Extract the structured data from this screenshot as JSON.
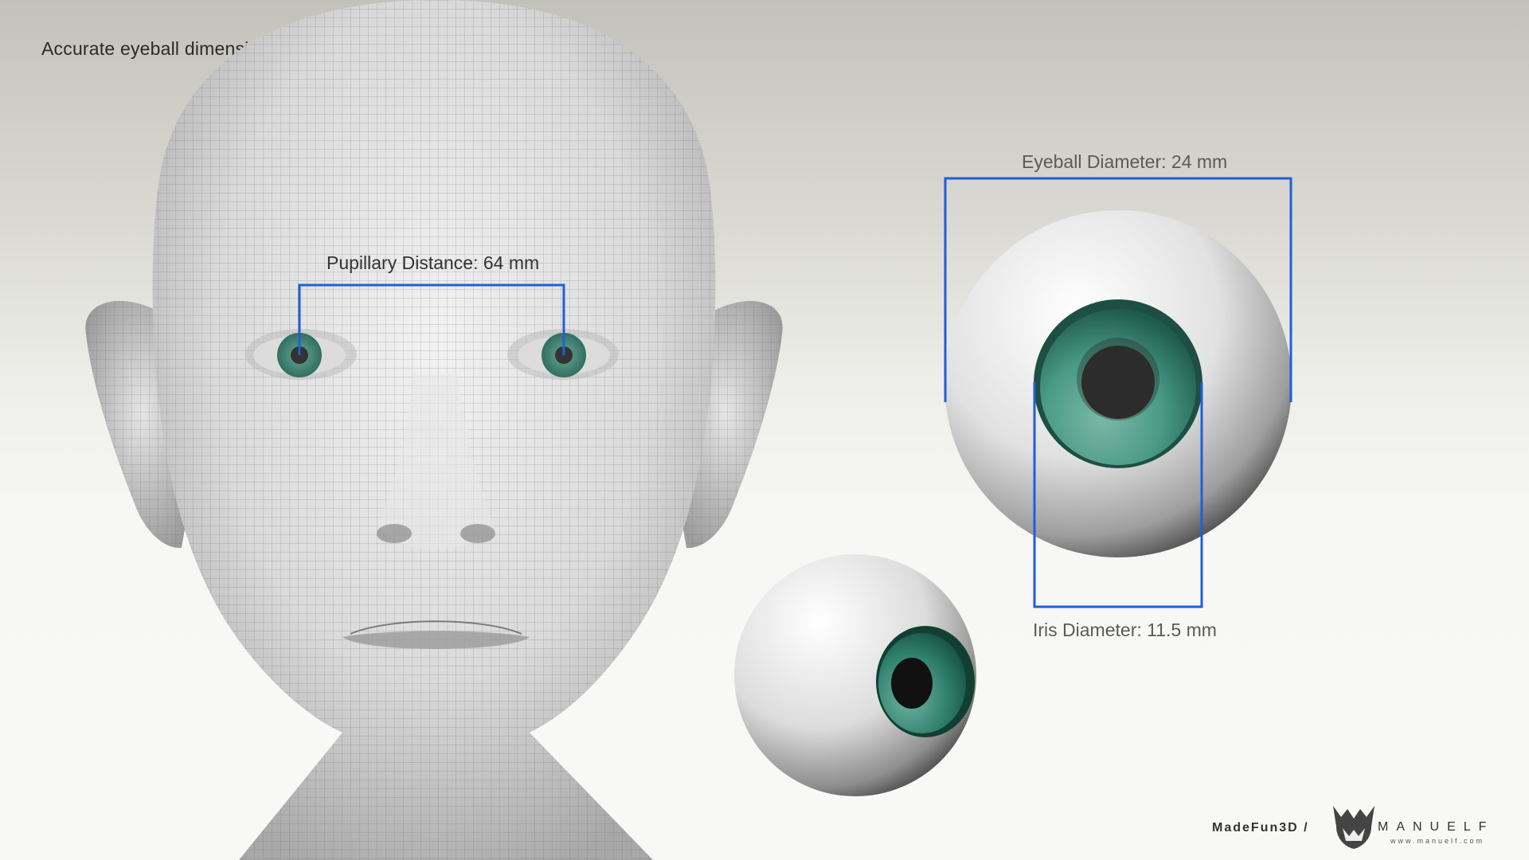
{
  "title": "Accurate eyeball dimensions",
  "labels": {
    "pupillary_distance": "Pupillary Distance: 64 mm",
    "eyeball_diameter": "Eyeball Diameter: 24 mm",
    "iris_diameter": "Iris Diameter: 11.5 mm"
  },
  "credit": {
    "studio": "MadeFun3D /",
    "brand": "MANUELF",
    "url": "www.manuelf.com"
  },
  "colors": {
    "dimension_line": "#1f5fd8",
    "iris": "#2f8a77",
    "pupil": "#222222",
    "sclera": "#d8d8d8"
  }
}
